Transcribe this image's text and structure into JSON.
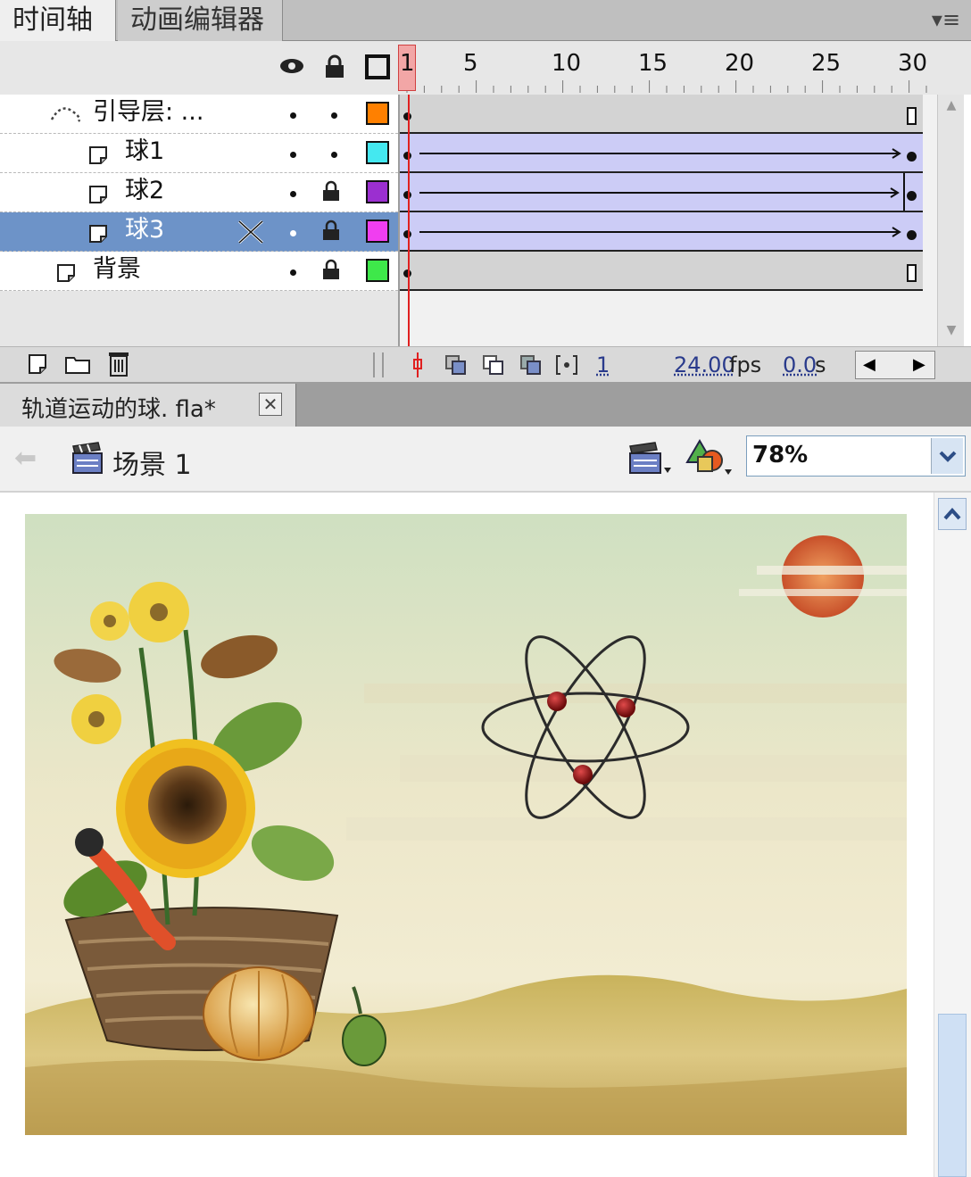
{
  "timeline": {
    "tabs": [
      {
        "label": "时间轴"
      },
      {
        "label": "动画编辑器"
      }
    ],
    "frame_numbers": [
      "1",
      "5",
      "10",
      "15",
      "20",
      "25",
      "30"
    ],
    "playhead_frame": 1,
    "layers": [
      {
        "name": "引导层: ...",
        "type": "guide",
        "color": "#ff8000",
        "locked": false,
        "selected": false
      },
      {
        "name": "球1",
        "type": "guided",
        "color": "#44e8f0",
        "locked": false,
        "selected": false
      },
      {
        "name": "球2",
        "type": "guided",
        "color": "#9b2fd0",
        "locked": true,
        "selected": false
      },
      {
        "name": "球3",
        "type": "guided",
        "color": "#f03ef0",
        "locked": true,
        "selected": true
      },
      {
        "name": "背景",
        "type": "normal",
        "color": "#3ee84a",
        "locked": true,
        "selected": false
      }
    ],
    "status": {
      "current_frame": "1",
      "fps": "24.00",
      "fps_unit": "fps",
      "time": "0.0",
      "time_unit": "s"
    }
  },
  "document": {
    "tab_label": "轨道运动的球. fla*",
    "scene_label": "场景 1",
    "zoom": "78%"
  }
}
